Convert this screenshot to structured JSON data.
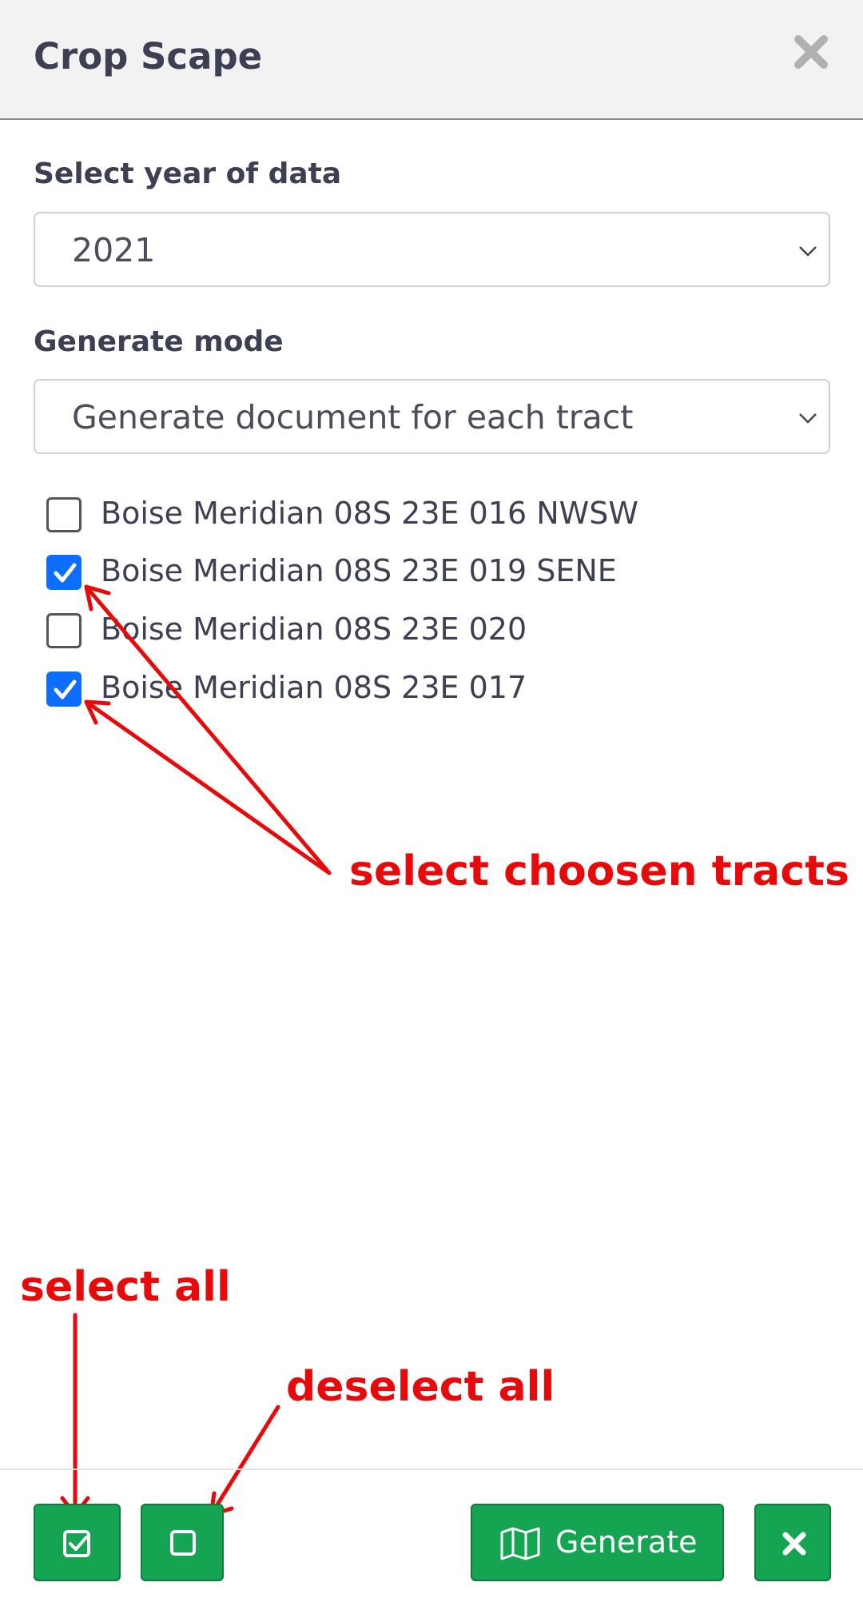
{
  "dialog": {
    "title": "Crop Scape"
  },
  "year": {
    "label": "Select year of data",
    "selected": "2021"
  },
  "mode": {
    "label": "Generate mode",
    "selected": "Generate document for each tract"
  },
  "tracts": [
    {
      "label": "Boise Meridian 08S 23E 016 NWSW",
      "checked": false
    },
    {
      "label": "Boise Meridian 08S 23E 019 SENE",
      "checked": true
    },
    {
      "label": "Boise Meridian 08S 23E 020",
      "checked": false
    },
    {
      "label": "Boise Meridian 08S 23E 017",
      "checked": true
    }
  ],
  "annotations": {
    "select_tracts": "select choosen tracts",
    "select_all": "select all",
    "deselect_all": "deselect all"
  },
  "footer": {
    "generate_label": "Generate"
  },
  "colors": {
    "accent": "#15a552",
    "checkbox": "#0d6efd",
    "annotation": "#e80a0a"
  },
  "icons": {
    "close": "close-icon",
    "select_all": "check-square-icon",
    "deselect_all": "square-icon",
    "generate": "map-icon",
    "footer_close": "times-icon"
  }
}
